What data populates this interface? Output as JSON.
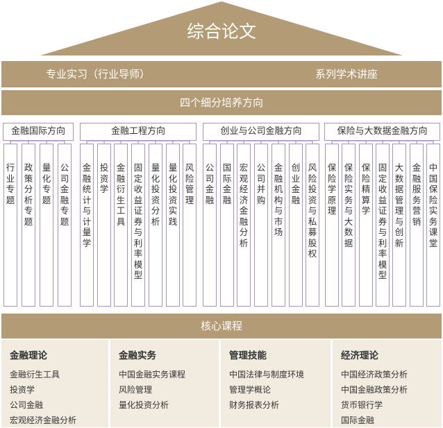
{
  "top_title": "综合论文",
  "row1": {
    "left": "专业实习（行业导师）",
    "right": "系列学术讲座"
  },
  "row2": "四个细分培养方向",
  "directions": [
    {
      "name": "金融国际方向",
      "courses": [
        "行业专题",
        "政策分析专题",
        "量化专题",
        "公司金融专题"
      ]
    },
    {
      "name": "金融工程方向",
      "courses": [
        "金融统计与计量学",
        "投资学",
        "金融衍生工具",
        "固定收益证券与利率模型",
        "量化投资分析",
        "量化投资实践",
        "风险管理"
      ]
    },
    {
      "name": "创业与公司金融方向",
      "courses": [
        "公司金融",
        "国际金融",
        "宏观经济金融分析",
        "公司并购",
        "金融机构与市场",
        "创业金融",
        "风险投资与私募股权"
      ]
    },
    {
      "name": "保险与大数据金融方向",
      "courses": [
        "保险学原理",
        "保险实务与大数据",
        "保险精算学",
        "固定收益证券与利率模型",
        "大数据管理与创新",
        "金融服务营销",
        "中国保险实务课堂"
      ]
    }
  ],
  "core_title": "核心课程",
  "core": [
    {
      "title": "金融理论",
      "items": [
        "金融衍生工具",
        "投资学",
        "公司金融",
        "宏观经济金融分析"
      ]
    },
    {
      "title": "金融实务",
      "items": [
        "中国金融实务课程",
        "风险管理",
        "量化投资分析"
      ]
    },
    {
      "title": "管理技能",
      "items": [
        "中国法律与制度环境",
        "管理学概论",
        "财务报表分析"
      ]
    },
    {
      "title": "经济理论",
      "items": [
        "中国经济政策分析",
        "中国金融政策分析",
        "货币银行学",
        "国际金融"
      ]
    }
  ],
  "colors": {
    "band": "#b39b76",
    "border": "#a88fc6",
    "cell_bg": "#f1ebe0"
  }
}
